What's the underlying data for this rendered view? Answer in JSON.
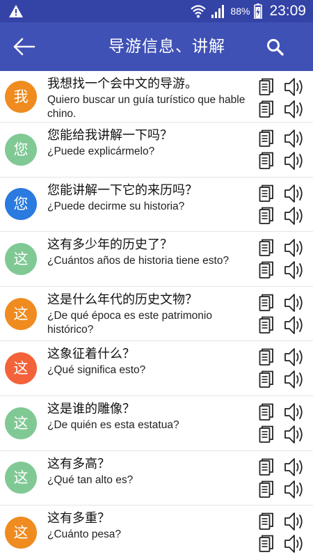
{
  "status_bar": {
    "battery_percent": "88%",
    "time": "23:09"
  },
  "app_bar": {
    "title": "导游信息、讲解"
  },
  "colors": {
    "status_bar": "#3443a6",
    "app_bar": "#3f51b5",
    "avatar_orange": "#ef8b1f",
    "avatar_green": "#80c995",
    "avatar_blue": "#2a7ae0",
    "avatar_red": "#f4623a"
  },
  "phrases": [
    {
      "avatar": "我",
      "avatar_color": "#ef8b1f",
      "zh": "我想找一个会中文的导游。",
      "es": "Quiero buscar un guía turístico que hable chino."
    },
    {
      "avatar": "您",
      "avatar_color": "#80c995",
      "zh": "您能给我讲解一下吗？",
      "es": "¿Puede explicármelo?"
    },
    {
      "avatar": "您",
      "avatar_color": "#2a7ae0",
      "zh": "您能讲解一下它的来历吗？",
      "es": "¿Puede decirme su historia?"
    },
    {
      "avatar": "这",
      "avatar_color": "#80c995",
      "zh": "这有多少年的历史了？",
      "es": "¿Cuántos años de historia tiene esto?"
    },
    {
      "avatar": "这",
      "avatar_color": "#ef8b1f",
      "zh": "这是什么年代的历史文物？",
      "es": "¿De qué época es este patrimonio histórico?"
    },
    {
      "avatar": "这",
      "avatar_color": "#f4623a",
      "zh": "这象征着什么？",
      "es": "¿Qué significa esto?"
    },
    {
      "avatar": "这",
      "avatar_color": "#80c995",
      "zh": "这是谁的雕像？",
      "es": "¿De quién es esta estatua?"
    },
    {
      "avatar": "这",
      "avatar_color": "#80c995",
      "zh": "这有多高？",
      "es": "¿Qué tan alto es?"
    },
    {
      "avatar": "这",
      "avatar_color": "#ef8b1f",
      "zh": "这有多重？",
      "es": "¿Cuánto pesa?"
    }
  ],
  "icons": {
    "warning": "warning-icon",
    "wifi": "wifi-icon",
    "signal": "signal-icon",
    "battery": "battery-charging-icon",
    "back": "arrow-left-icon",
    "search": "search-icon",
    "copy": "copy-icon",
    "speaker": "speaker-icon"
  }
}
